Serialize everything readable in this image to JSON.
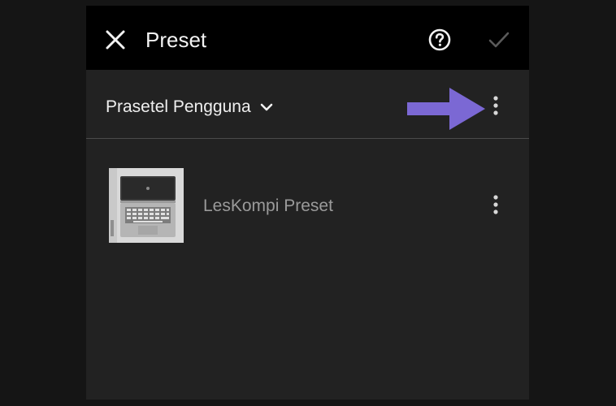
{
  "header": {
    "title": "Preset",
    "close_icon": "close-icon",
    "help_icon": "help-circle-icon",
    "confirm_icon": "checkmark-icon"
  },
  "group": {
    "label": "Prasetel Pengguna",
    "dropdown_icon": "chevron-down-icon",
    "more_icon": "more-vertical-icon"
  },
  "presets": [
    {
      "name": "LesKompi Preset",
      "thumbnail": "laptop-thumbnail",
      "more_icon": "more-vertical-icon"
    }
  ],
  "annotation": {
    "arrow_icon": "arrow-right-icon",
    "arrow_color": "#7b68d4"
  },
  "colors": {
    "background": "#222222",
    "topbar": "#000000",
    "text": "#efefef",
    "muted_text": "#9a9a9a"
  }
}
